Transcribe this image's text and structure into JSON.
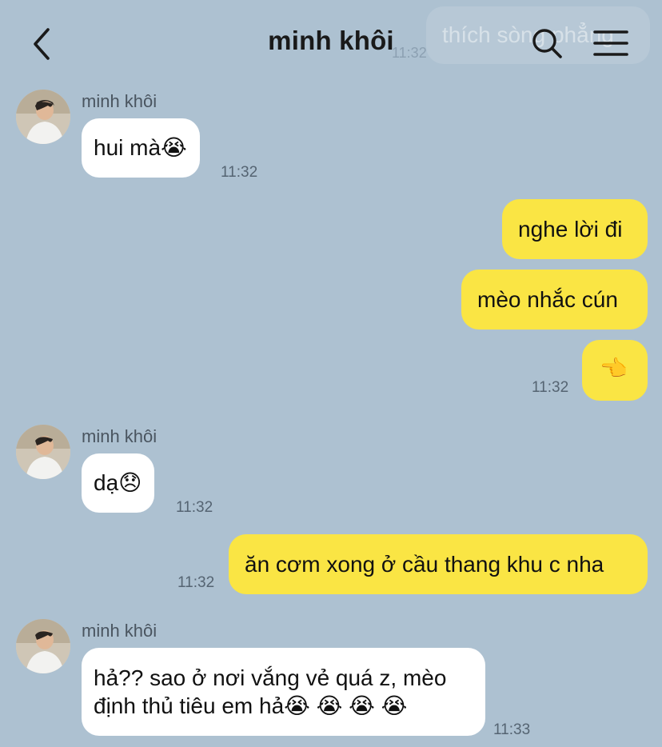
{
  "header": {
    "title": "minh khôi",
    "ghost_text": "thích sòng phẳng",
    "ghost_time": "11:32"
  },
  "messages": [
    {
      "side": "in",
      "sender": "minh khôi",
      "text": "hui mà😭",
      "time": "11:32"
    },
    {
      "side": "out",
      "text": "nghe lời đi"
    },
    {
      "side": "out",
      "text": "mèo nhắc cún"
    },
    {
      "side": "out",
      "text": "👈",
      "time": "11:32"
    },
    {
      "side": "in",
      "sender": "minh khôi",
      "text": "dạ😞",
      "time": "11:32"
    },
    {
      "side": "out",
      "text": "ăn cơm xong ở cầu thang khu c nha",
      "time": "11:32"
    },
    {
      "side": "in",
      "sender": "minh khôi",
      "line1": "hả?? sao ở nơi vắng vẻ quá z, mèo",
      "line2": "định thủ tiêu em hả😭 😭 😭 😭",
      "time": "11:33"
    }
  ],
  "colors": {
    "background": "#adc1d1",
    "incoming_bubble": "#ffffff",
    "outgoing_bubble": "#fae544"
  },
  "icons": [
    "chevron-left-icon",
    "search-icon",
    "menu-icon",
    "pointing-hand-icon"
  ]
}
